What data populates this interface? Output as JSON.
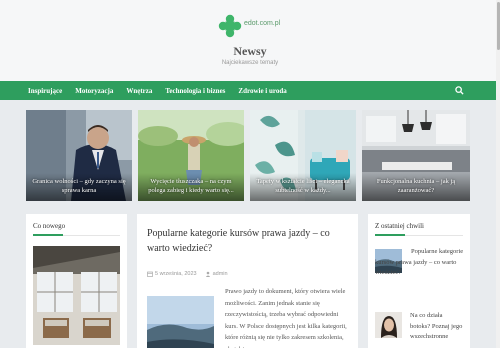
{
  "site": {
    "logo_text": "edot.com.pl",
    "title": "Newsy",
    "tagline": "Najciekawsze tematy"
  },
  "nav": {
    "items": [
      "Inspirujące",
      "Motoryzacja",
      "Wnętrza",
      "Technologia i biznes",
      "Zdrowie i uroda"
    ],
    "search_icon": "search-icon"
  },
  "featured": [
    {
      "caption": "Granica wolności – gdy zaczyna się sprawa karna"
    },
    {
      "caption": "Wycięcie tłuszczaka – na czym polega zabieg i kiedy warto się..."
    },
    {
      "caption": "Tapety w kształcie liści – elegancka subtelność w każdy..."
    },
    {
      "caption": "Funkcjonalna kuchnia – jak ją zaaranżować?"
    }
  ],
  "left_widget": {
    "title": "Co nowego"
  },
  "article": {
    "title": "Popularne kategorie kursów prawa jazdy – co warto wiedzieć?",
    "date": "5 września, 2023",
    "author": "admin",
    "excerpt": "Prawo jazdy to dokument, który otwiera wiele możliwości. Zanim jednak stanie się rzeczywistością, trzeba wybrać odpowiedni kurs. W Polsce dostępnych jest kilka kategorii, które różnią się nie tylko zakresem szkolenia, ale także"
  },
  "right_widget": {
    "title": "Z ostatniej chwili",
    "items": [
      {
        "title": "Popularne kategorie kursów prawa jazdy – co warto wiedzieć?"
      },
      {
        "title": "Na co działa botoks? Poznaj jego wszechstronne"
      }
    ]
  },
  "colors": {
    "accent": "#2e9e5e",
    "background": "#e8ebee"
  }
}
